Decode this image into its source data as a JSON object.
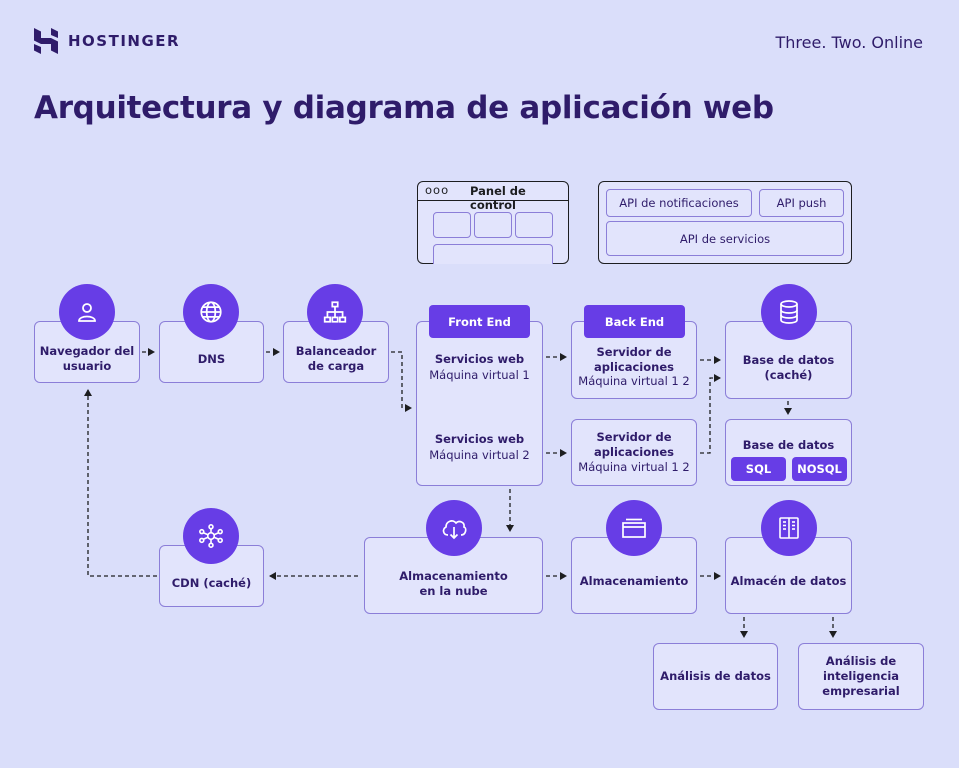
{
  "header": {
    "logo_text": "HOSTINGER",
    "tagline": "Three. Two. Online"
  },
  "title": "Arquitectura y diagrama de aplicación web",
  "panel": {
    "title": "Panel de control",
    "dots": "ooo"
  },
  "api": {
    "notifications": "API de notificaciones",
    "push": "API push",
    "services": "API de servicios"
  },
  "nodes": {
    "browser_line1": "Navegador del",
    "browser_line2": "usuario",
    "dns": "DNS",
    "balancer_line1": "Balanceador",
    "balancer_line2": "de carga",
    "frontend_label": "Front End",
    "web1_title": "Servicios web",
    "web1_sub": "Máquina virtual 1",
    "web2_title": "Servicios web",
    "web2_sub": "Máquina virtual 2",
    "backend_label": "Back End",
    "app1_line1": "Servidor de",
    "app1_line2": "aplicaciones",
    "app1_sub": "Máquina virtual 1 2",
    "app2_line1": "Servidor de",
    "app2_line2": "aplicaciones",
    "app2_sub": "Máquina virtual 1 2",
    "db_cache_line1": "Base de datos",
    "db_cache_line2": "(caché)",
    "db_title": "Base de datos",
    "sql": "SQL",
    "nosql": "NOSQL",
    "cdn": "CDN (caché)",
    "cloud_line1": "Almacenamiento",
    "cloud_line2": "en la nube",
    "storage": "Almacenamiento",
    "warehouse": "Almacén de datos",
    "analytics": "Análisis de datos",
    "bi_line1": "Análisis de",
    "bi_line2": "inteligencia",
    "bi_line3": "empresarial"
  },
  "colors": {
    "background": "#dadefa",
    "accent": "#673de6",
    "text": "#2f1c6a",
    "border": "#8b7ed8"
  }
}
